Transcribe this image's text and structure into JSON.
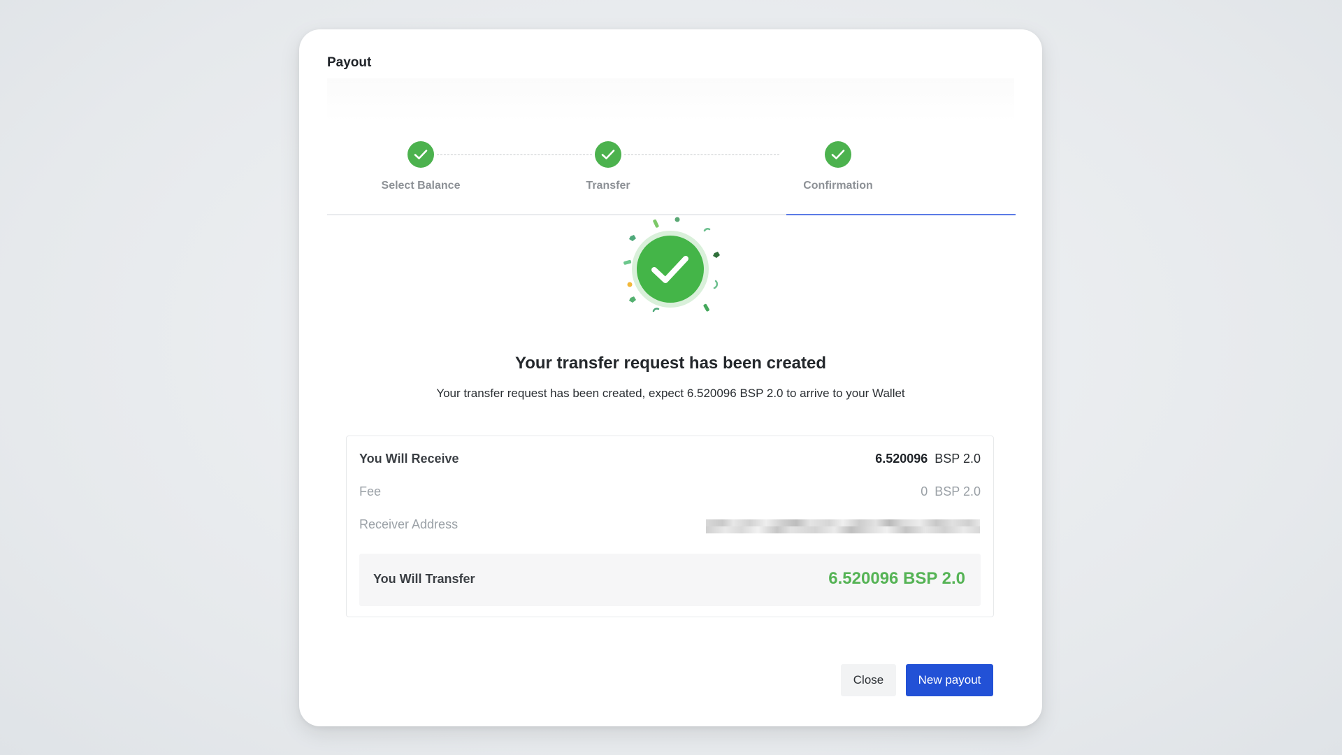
{
  "modal": {
    "title": "Payout"
  },
  "stepper": {
    "steps": [
      {
        "label": "Select Balance",
        "status": "complete"
      },
      {
        "label": "Transfer",
        "status": "complete"
      },
      {
        "label": "Confirmation",
        "status": "complete"
      }
    ],
    "active_step": "Confirmation"
  },
  "result": {
    "headline": "Your transfer request has been created",
    "message": "Your transfer request has been created, expect 6.520096 BSP 2.0 to arrive to your Wallet"
  },
  "summary": {
    "receive": {
      "label": "You Will Receive",
      "amount": "6.520096",
      "currency": "BSP 2.0"
    },
    "fee": {
      "label": "Fee",
      "amount": "0",
      "currency": "BSP 2.0"
    },
    "receiver_address": {
      "label": "Receiver Address"
    },
    "transfer": {
      "label": "You Will Transfer",
      "value": "6.520096 BSP 2.0"
    }
  },
  "actions": {
    "close_label": "Close",
    "new_payout_label": "New payout"
  },
  "colors": {
    "success_green": "#4cb24e",
    "transfer_green": "#55b355",
    "primary_blue": "#2251d6",
    "active_underline": "#5b7be6"
  },
  "icons": {
    "step_complete": "check-icon",
    "success_badge": "check-circle-icon"
  }
}
